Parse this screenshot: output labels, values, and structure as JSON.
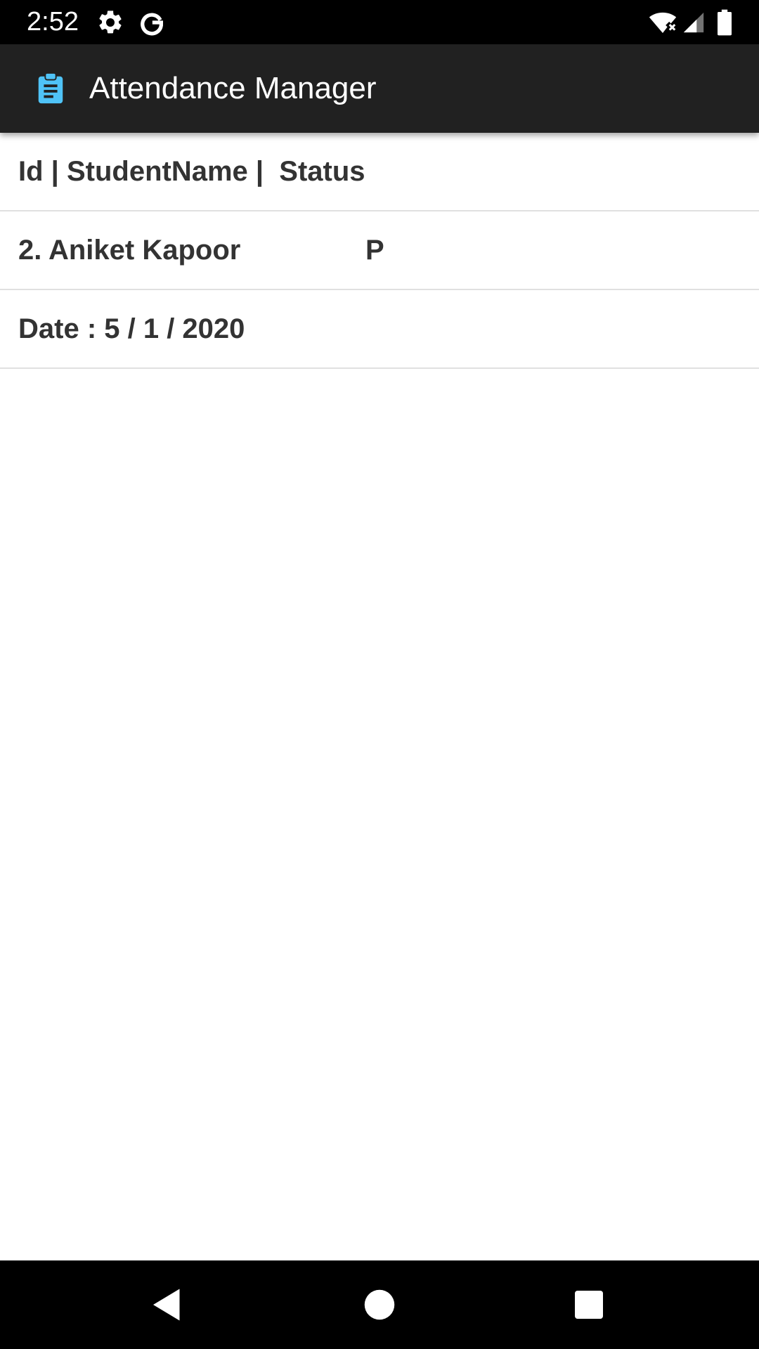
{
  "status_bar": {
    "time": "2:52",
    "icons": [
      "settings-icon",
      "google-icon",
      "wifi-icon",
      "signal-icon",
      "battery-icon"
    ]
  },
  "app_bar": {
    "title": "Attendance Manager",
    "icon": "clipboard-icon",
    "icon_color": "#4fc3f7",
    "background": "#212121"
  },
  "list": {
    "header": "Id | StudentName |  Status",
    "record": {
      "student": "2. Aniket Kapoor",
      "status": "P"
    },
    "date": "Date : 5 / 1 / 2020"
  },
  "nav_bar": {
    "buttons": [
      "back-icon",
      "home-icon",
      "recents-icon"
    ]
  }
}
